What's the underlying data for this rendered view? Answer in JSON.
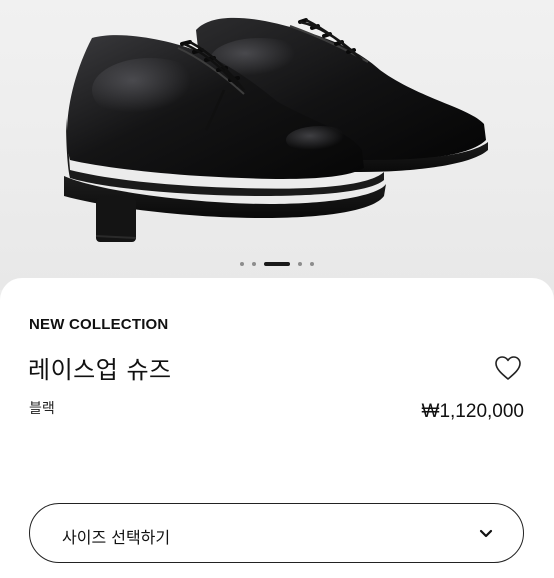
{
  "gallery": {
    "image_alt": "black lace-up derby shoes",
    "slide_count": 5,
    "active_slide": 3
  },
  "product": {
    "collection": "NEW COLLECTION",
    "name": "레이스업 슈즈",
    "color": "블랙",
    "price": "₩1,120,000"
  },
  "size_selector": {
    "label": "사이즈 선택하기"
  },
  "icons": {
    "wishlist": "heart-icon",
    "dropdown": "chevron-down-icon"
  },
  "colors": {
    "background": "#ececec",
    "sheet": "#ffffff",
    "text": "#111111",
    "active_dot": "#1a1a1a",
    "inactive_dot": "#8d8d8d"
  }
}
